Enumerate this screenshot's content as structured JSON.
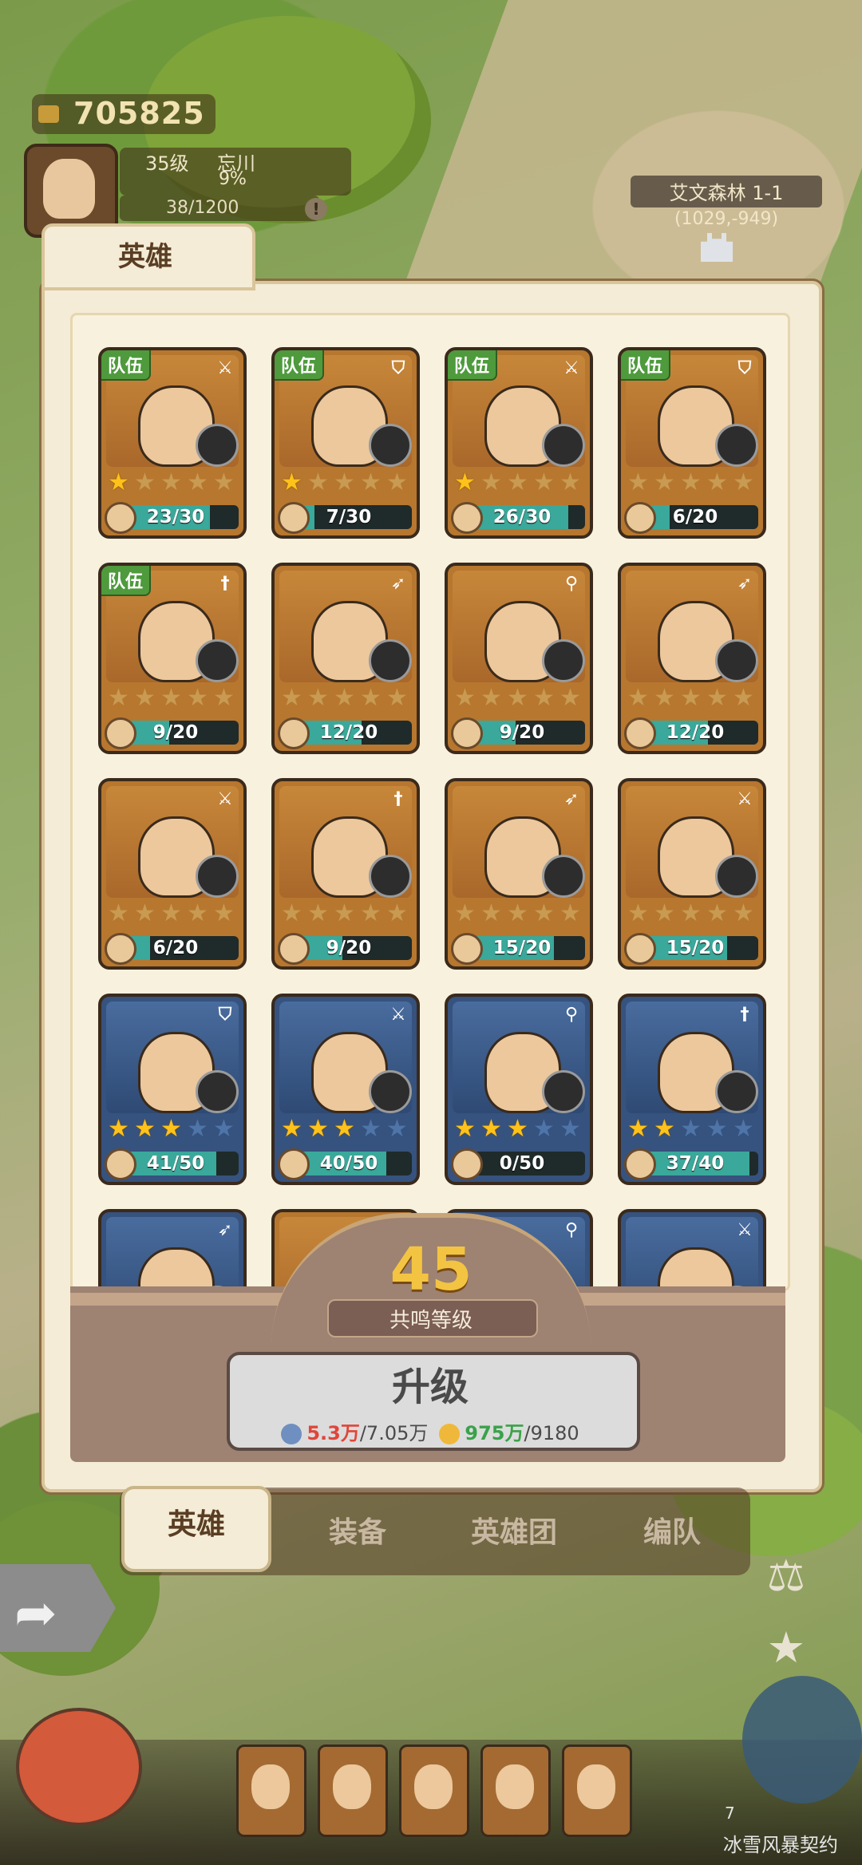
{
  "hud": {
    "coins": "705825",
    "player_level": "35级",
    "player_name": "忘川",
    "exp_percent": "9%",
    "stamina": "38/1200",
    "stage_name": "艾文森林 1-1",
    "coordinates": "(1029,-949)"
  },
  "panel": {
    "title": "英雄",
    "team_badge": "队伍",
    "heroes": [
      {
        "count": "23/30",
        "stars": 1,
        "max_stars": 5,
        "team": true,
        "role": "axe",
        "rarity": "brown",
        "progress": 0.77
      },
      {
        "count": "7/30",
        "stars": 1,
        "max_stars": 5,
        "team": true,
        "role": "shield",
        "rarity": "brown",
        "progress": 0.23
      },
      {
        "count": "26/30",
        "stars": 1,
        "max_stars": 5,
        "team": true,
        "role": "axe",
        "rarity": "brown",
        "progress": 0.87
      },
      {
        "count": "6/20",
        "stars": 0,
        "max_stars": 5,
        "team": true,
        "role": "shield",
        "rarity": "brown",
        "progress": 0.3
      },
      {
        "count": "9/20",
        "stars": 0,
        "max_stars": 5,
        "team": true,
        "role": "sword",
        "rarity": "brown",
        "progress": 0.45
      },
      {
        "count": "12/20",
        "stars": 0,
        "max_stars": 5,
        "team": false,
        "role": "bow",
        "rarity": "brown",
        "progress": 0.6
      },
      {
        "count": "9/20",
        "stars": 0,
        "max_stars": 5,
        "team": false,
        "role": "staff",
        "rarity": "brown",
        "progress": 0.45
      },
      {
        "count": "12/20",
        "stars": 0,
        "max_stars": 5,
        "team": false,
        "role": "bow",
        "rarity": "brown",
        "progress": 0.6
      },
      {
        "count": "6/20",
        "stars": 0,
        "max_stars": 5,
        "team": false,
        "role": "axe",
        "rarity": "brown",
        "progress": 0.3
      },
      {
        "count": "9/20",
        "stars": 0,
        "max_stars": 5,
        "team": false,
        "role": "sword",
        "rarity": "brown",
        "progress": 0.45
      },
      {
        "count": "15/20",
        "stars": 0,
        "max_stars": 5,
        "team": false,
        "role": "bow",
        "rarity": "brown",
        "progress": 0.75
      },
      {
        "count": "15/20",
        "stars": 0,
        "max_stars": 5,
        "team": false,
        "role": "axe",
        "rarity": "brown",
        "progress": 0.75
      },
      {
        "count": "41/50",
        "stars": 3,
        "max_stars": 5,
        "team": false,
        "role": "shield",
        "rarity": "blue",
        "progress": 0.82
      },
      {
        "count": "40/50",
        "stars": 3,
        "max_stars": 5,
        "team": false,
        "role": "axe",
        "rarity": "blue",
        "progress": 0.8
      },
      {
        "count": "0/50",
        "stars": 3,
        "max_stars": 5,
        "team": false,
        "role": "staff",
        "rarity": "blue",
        "progress": 0.0
      },
      {
        "count": "37/40",
        "stars": 2,
        "max_stars": 5,
        "team": false,
        "role": "sword",
        "rarity": "blue",
        "progress": 0.93
      },
      {
        "count": "",
        "stars": 0,
        "max_stars": 5,
        "team": false,
        "role": "bow",
        "rarity": "blue",
        "progress": 0
      },
      {
        "count": "",
        "stars": 0,
        "max_stars": 5,
        "team": false,
        "role": "axe",
        "rarity": "brown",
        "progress": 0
      },
      {
        "count": "",
        "stars": 0,
        "max_stars": 5,
        "team": false,
        "role": "staff",
        "rarity": "blue",
        "progress": 0
      },
      {
        "count": "",
        "stars": 0,
        "max_stars": 5,
        "team": false,
        "role": "axe",
        "rarity": "blue",
        "progress": 0
      }
    ]
  },
  "resonance": {
    "level": "45",
    "label": "共鸣等级",
    "upgrade_label": "升级",
    "gem_have": "5.3万",
    "gem_need": "/7.05万",
    "gold_have": "975万",
    "gold_need": "/9180"
  },
  "tabs": [
    {
      "label": "英雄",
      "active": true
    },
    {
      "label": "装备",
      "active": false
    },
    {
      "label": "英雄团",
      "active": false
    },
    {
      "label": "编队",
      "active": false
    }
  ],
  "bottom": {
    "event_count": "7",
    "event_name": "冰雪风暴契约"
  },
  "icons": {
    "axe": "⚔",
    "shield": "⛉",
    "sword": "†",
    "bow": "➶",
    "staff": "⚲"
  },
  "colors": {
    "panel_bg": "#f4ecd6",
    "team_badge": "#4e9a3c",
    "resonance_level": "#f3c441",
    "cost_insufficient": "#e0463a",
    "cost_sufficient": "#3aa24a"
  }
}
